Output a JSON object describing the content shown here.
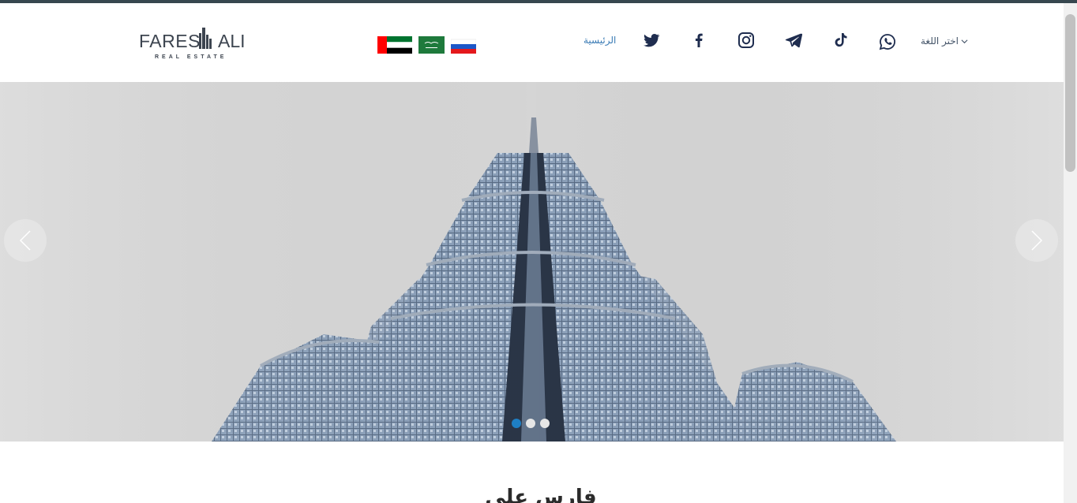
{
  "header": {
    "logo": {
      "primary_text": "FARES ALI",
      "secondary_text": "REAL ESTATE",
      "icon": "building-icon"
    },
    "flags": [
      {
        "name": "uae-flag-icon",
        "country": "United Arab Emirates"
      },
      {
        "name": "saudi-flag-icon",
        "country": "Saudi Arabia"
      },
      {
        "name": "russia-flag-icon",
        "country": "Russia"
      }
    ],
    "nav_home": "الرئيسية",
    "social_icons": [
      "twitter-icon",
      "facebook-icon",
      "instagram-icon",
      "telegram-icon",
      "tiktok-icon",
      "whatsapp-icon"
    ],
    "language_label": "اختر اللغة",
    "colors": {
      "icon": "#1f2d4f",
      "link": "#3a7bb5",
      "topline": "#37474f"
    }
  },
  "hero": {
    "slides_total": 3,
    "active_slide": 1,
    "background": "#d9d9d9",
    "prev_icon": "chevron-left-icon",
    "next_icon": "chevron-right-icon",
    "active_dot_color": "#1e7fc4"
  },
  "main": {
    "section_title": "فارس علي"
  }
}
